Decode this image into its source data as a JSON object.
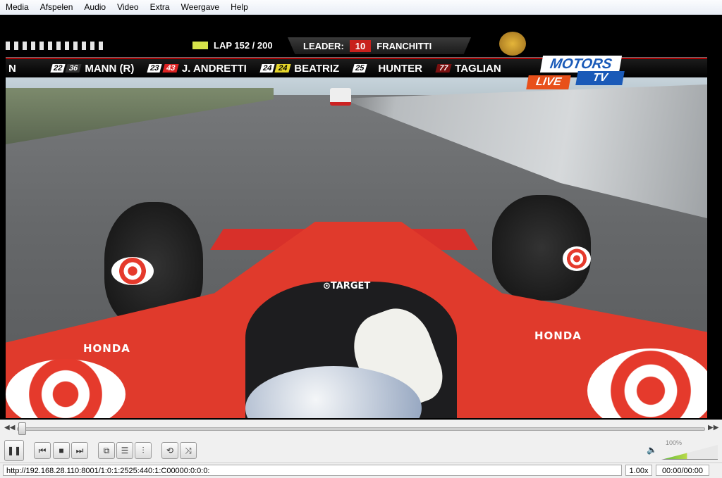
{
  "menu": [
    "Media",
    "Afspelen",
    "Audio",
    "Video",
    "Extra",
    "Weergave",
    "Help"
  ],
  "video": {
    "lap_label": "LAP 152 / 200",
    "leader_label": "LEADER:",
    "leader_number": "10",
    "leader_name": "FRANCHITTI",
    "ticker": [
      {
        "pos": "",
        "num": "",
        "name": "N"
      },
      {
        "pos": "22",
        "num": "36",
        "name": "MANN (R)"
      },
      {
        "pos": "23",
        "num": "43",
        "name": "J. ANDRETTI"
      },
      {
        "pos": "24",
        "num": "24",
        "name": "BEATRIZ"
      },
      {
        "pos": "25",
        "num": "",
        "name": "HUNTER"
      },
      {
        "pos": "",
        "num": "77",
        "name": "TAGLIAN"
      }
    ],
    "brand_top": "MOTORS",
    "brand_tv": "TV",
    "brand_live": "LIVE",
    "car_sponsor_1": "HONDA",
    "car_sponsor_2": "HONDA",
    "car_sponsor_3": "⊙TARGET"
  },
  "seek": {
    "progress": 0.0
  },
  "controls": {
    "play_pause": "pause-icon",
    "prev": "previous-icon",
    "stop": "stop-icon",
    "next": "next-icon",
    "fullscreen": "fullscreen-icon",
    "playlist": "playlist-icon",
    "extended": "equalizer-icon",
    "loop": "loop-icon",
    "shuffle": "shuffle-icon",
    "volume_label": "100%",
    "volume_level": 1.0
  },
  "status": {
    "url": "http://192.168.28.110:8001/1:0:1:2525:440:1:C00000:0:0:0:",
    "speed": "1.00x",
    "time": "00:00/00:00"
  }
}
